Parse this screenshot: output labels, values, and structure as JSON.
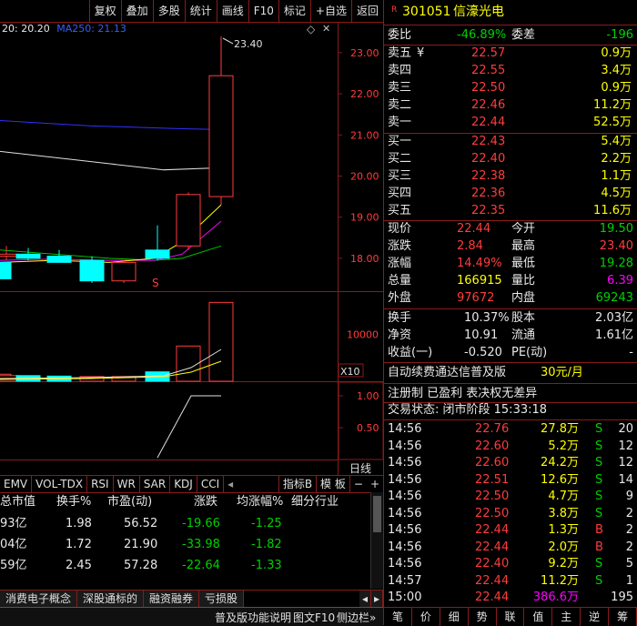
{
  "toolbar": {
    "buttons": [
      "复权",
      "叠加",
      "多股",
      "统计",
      "画线",
      "F10",
      "标记",
      "+自选",
      "返回"
    ]
  },
  "chart_legend": {
    "ma20": "20: 20.20",
    "ma250": "MA250: 21.13"
  },
  "price_chart": {
    "high_label": "23.40",
    "axis": [
      "23.00",
      "22.00",
      "21.00",
      "20.00",
      "19.00",
      "18.00"
    ],
    "signal_marker": "S",
    "candles": [
      {
        "open": 17.9,
        "high": 18.45,
        "low": 17.6,
        "close": 17.5,
        "color": "cyan"
      },
      {
        "open": 18.1,
        "high": 18.3,
        "low": 17.95,
        "close": 18.05,
        "color": "red"
      },
      {
        "open": 18.1,
        "high": 18.25,
        "low": 17.95,
        "close": 18.0,
        "color": "cyan"
      },
      {
        "open": 18.05,
        "high": 18.2,
        "low": 17.9,
        "close": 17.9,
        "color": "cyan"
      },
      {
        "open": 17.95,
        "high": 18.05,
        "low": 17.4,
        "close": 17.45,
        "color": "cyan"
      },
      {
        "open": 17.45,
        "high": 17.95,
        "low": 17.4,
        "close": 17.9,
        "color": "red"
      },
      {
        "open": 18.2,
        "high": 18.8,
        "low": 17.95,
        "close": 18.0,
        "color": "cyan"
      },
      {
        "open": 18.3,
        "high": 19.6,
        "low": 18.2,
        "close": 19.55,
        "color": "red"
      },
      {
        "open": 19.5,
        "high": 23.4,
        "low": 19.3,
        "close": 22.44,
        "color": "red"
      }
    ]
  },
  "volume_chart": {
    "axis": [
      "10000"
    ],
    "unit": "X10",
    "bars": [
      {
        "value": 1500,
        "color": "red"
      },
      {
        "value": 1200,
        "color": "red"
      },
      {
        "value": 1200,
        "color": "cyan"
      },
      {
        "value": 1100,
        "color": "cyan"
      },
      {
        "value": 1000,
        "color": "red"
      },
      {
        "value": 1000,
        "color": "red"
      },
      {
        "value": 2000,
        "color": "cyan"
      },
      {
        "value": 7500,
        "color": "red"
      },
      {
        "value": 16800,
        "color": "red"
      }
    ]
  },
  "indicator_chart": {
    "axis": [
      "1.00",
      "0.50"
    ]
  },
  "period_label": "日线",
  "indicator_tabs": [
    "EMV",
    "VOL-TDX",
    "RSI",
    "WR",
    "SAR",
    "KDJ",
    "CCI"
  ],
  "indicator_extra": [
    "指标B",
    "模 板"
  ],
  "list": {
    "headers": [
      "总市值",
      "换手%",
      "市盈(动)",
      "涨跌",
      "均涨幅%",
      "细分行业"
    ],
    "rows": [
      [
        "93亿",
        "1.98",
        "56.52",
        "-19.66",
        "-1.25",
        ""
      ],
      [
        "04亿",
        "1.72",
        "21.90",
        "-33.98",
        "-1.82",
        ""
      ],
      [
        "59亿",
        "2.45",
        "57.28",
        "-22.64",
        "-1.33",
        ""
      ]
    ]
  },
  "bottom_tabs": [
    "消费电子概念",
    "深股通标的",
    "融资融券",
    "亏损股"
  ],
  "status_bar": [
    "普及版功能说明",
    "图文F10",
    "侧边栏»"
  ],
  "quote": {
    "badge": "R",
    "code": "301051",
    "name": "信濠光电",
    "weibi_label": "委比",
    "weibi_value": "-46.89%",
    "weicha_label": "委差",
    "weicha_value": "-196",
    "sell": [
      {
        "label": "卖五",
        "mark": "¥",
        "price": "22.57",
        "vol": "0.9万"
      },
      {
        "label": "卖四",
        "mark": "",
        "price": "22.55",
        "vol": "3.4万"
      },
      {
        "label": "卖三",
        "mark": "",
        "price": "22.50",
        "vol": "0.9万"
      },
      {
        "label": "卖二",
        "mark": "",
        "price": "22.46",
        "vol": "11.2万"
      },
      {
        "label": "卖一",
        "mark": "",
        "price": "22.44",
        "vol": "52.5万"
      }
    ],
    "buy": [
      {
        "label": "买一",
        "price": "22.43",
        "vol": "5.4万"
      },
      {
        "label": "买二",
        "price": "22.40",
        "vol": "2.2万"
      },
      {
        "label": "买三",
        "price": "22.38",
        "vol": "1.1万"
      },
      {
        "label": "买四",
        "price": "22.36",
        "vol": "4.5万"
      },
      {
        "label": "买五",
        "price": "22.35",
        "vol": "11.6万"
      }
    ],
    "stats": [
      {
        "l1": "现价",
        "v1": "22.44",
        "c1": "red",
        "l2": "今开",
        "v2": "19.50",
        "c2": "green"
      },
      {
        "l1": "涨跌",
        "v1": "2.84",
        "c1": "red",
        "l2": "最高",
        "v2": "23.40",
        "c2": "red"
      },
      {
        "l1": "涨幅",
        "v1": "14.49%",
        "c1": "red",
        "l2": "最低",
        "v2": "19.28",
        "c2": "green"
      },
      {
        "l1": "总量",
        "v1": "166915",
        "c1": "yellow",
        "l2": "量比",
        "v2": "6.39",
        "c2": "magenta"
      },
      {
        "l1": "外盘",
        "v1": "97672",
        "c1": "red",
        "l2": "内盘",
        "v2": "69243",
        "c2": "green"
      }
    ],
    "finance": [
      {
        "l1": "换手",
        "v1": "10.37%",
        "l2": "股本",
        "v2": "2.03亿"
      },
      {
        "l1": "净资",
        "v1": "10.91",
        "l2": "流通",
        "v2": "1.61亿"
      },
      {
        "l1": "收益(一)",
        "v1": "-0.520",
        "l2": "PE(动)",
        "v2": "-"
      }
    ],
    "promo": "自动续费通达信普及版",
    "promo_price": "30元/月",
    "company_flags": "注册制 已盈利 表决权无差异",
    "trade_status": "交易状态: 闭市阶段 15:33:18",
    "ticks": [
      {
        "time": "14:56",
        "price": "22.76",
        "vol": "27.8万",
        "bs": "S",
        "n": "20"
      },
      {
        "time": "14:56",
        "price": "22.60",
        "vol": "5.2万",
        "bs": "S",
        "n": "12"
      },
      {
        "time": "14:56",
        "price": "22.60",
        "vol": "24.2万",
        "bs": "S",
        "n": "12"
      },
      {
        "time": "14:56",
        "price": "22.51",
        "vol": "12.6万",
        "bs": "S",
        "n": "14"
      },
      {
        "time": "14:56",
        "price": "22.50",
        "vol": "4.7万",
        "bs": "S",
        "n": "9"
      },
      {
        "time": "14:56",
        "price": "22.50",
        "vol": "3.8万",
        "bs": "S",
        "n": "2"
      },
      {
        "time": "14:56",
        "price": "22.44",
        "vol": "1.3万",
        "bs": "B",
        "n": "2"
      },
      {
        "time": "14:56",
        "price": "22.44",
        "vol": "2.0万",
        "bs": "B",
        "n": "2"
      },
      {
        "time": "14:56",
        "price": "22.40",
        "vol": "9.2万",
        "bs": "S",
        "n": "5"
      },
      {
        "time": "14:57",
        "price": "22.44",
        "vol": "11.2万",
        "bs": "S",
        "n": "1"
      },
      {
        "time": "15:00",
        "price": "22.44",
        "vol": "386.6万",
        "bs": "",
        "n": "195"
      }
    ],
    "bottom_buttons": [
      "笔",
      "价",
      "细",
      "势",
      "联",
      "值",
      "主",
      "逆",
      "筹"
    ]
  },
  "colors": {
    "up": "#ff3c3c",
    "down": "#00ffff",
    "border": "#8a1a1a",
    "ma_blue": "#3030ff",
    "ma_white": "#e0e0e0",
    "ma_yellow": "#ffff00",
    "ma_magenta": "#ff00ff",
    "ma_green": "#00c000"
  }
}
